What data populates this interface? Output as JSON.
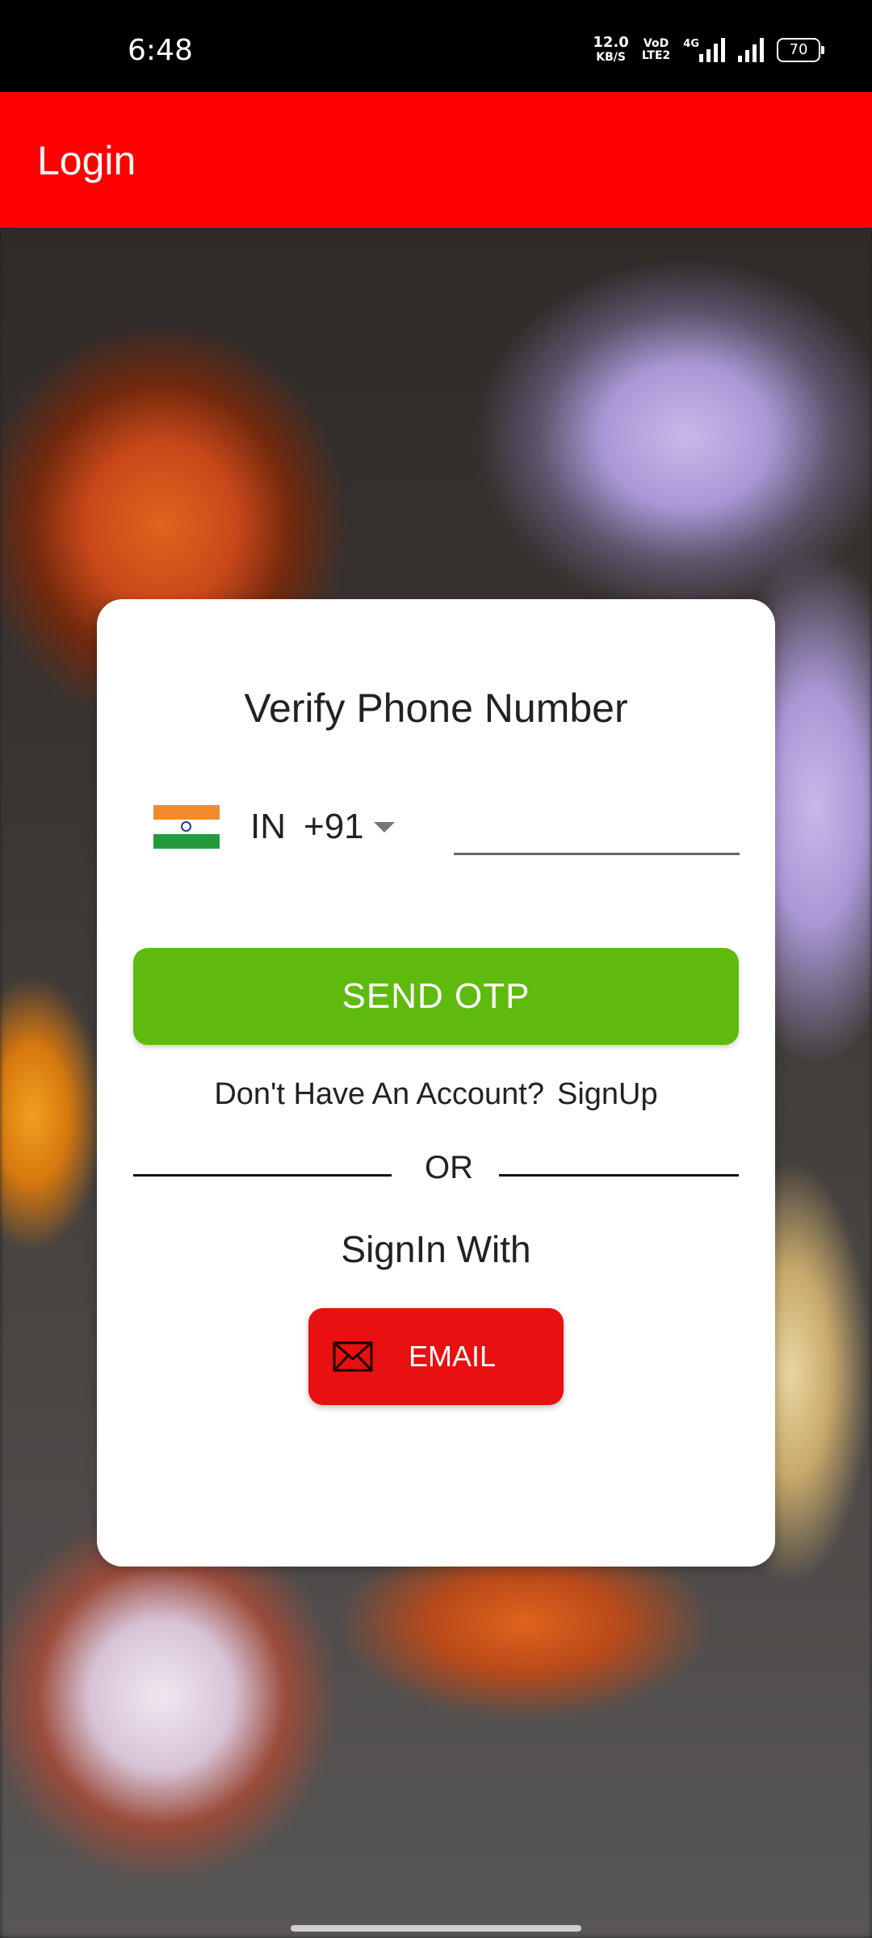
{
  "status_bar": {
    "time": "6:48",
    "net_speed_value": "12.0",
    "net_speed_unit": "KB/S",
    "volte_top": "VoD",
    "volte_bottom": "LTE2",
    "network_type": "4G",
    "battery": "70"
  },
  "app_bar": {
    "title": "Login"
  },
  "card": {
    "title": "Verify Phone Number",
    "country": {
      "code": "IN",
      "dial_code": "+91",
      "flag": "india-flag-icon"
    },
    "phone_input": {
      "value": "",
      "placeholder": ""
    },
    "send_otp_label": "SEND OTP",
    "signup_prompt": "Don't Have An Account?",
    "signup_link": "SignUp",
    "or_text": "OR",
    "signin_with": "SignIn With",
    "email_button_label": "EMAIL"
  },
  "colors": {
    "app_bar": "#ff0000",
    "send_otp": "#5fba0e",
    "email_button": "#e81010"
  }
}
